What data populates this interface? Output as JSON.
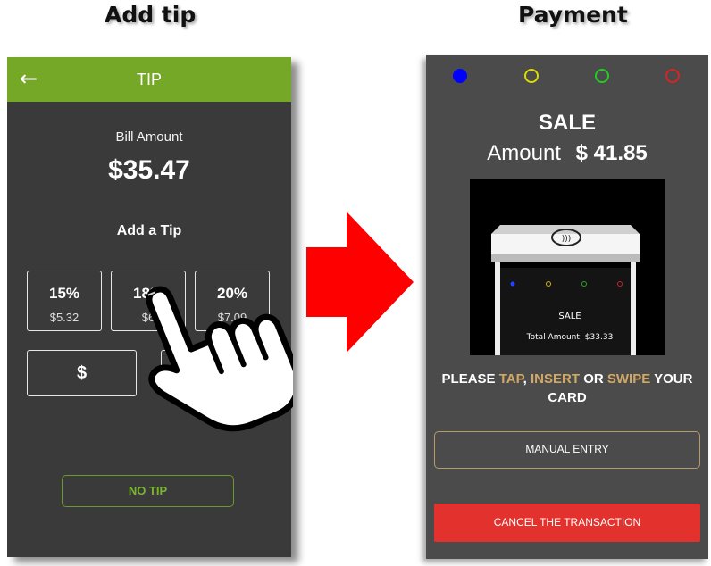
{
  "captions": {
    "left": "Add tip",
    "right": "Payment"
  },
  "tip_screen": {
    "title": "TIP",
    "bill_label": "Bill Amount",
    "bill_amount": "$35.47",
    "add_tip_label": "Add a Tip",
    "options": [
      {
        "percent": "15%",
        "amount": "$5.32"
      },
      {
        "percent": "18%",
        "amount": "$6"
      },
      {
        "percent": "20%",
        "amount": "$7.09"
      }
    ],
    "custom_label": "$",
    "no_tip_label": "NO TIP",
    "accent_color": "#76a828"
  },
  "payment_screen": {
    "leds": [
      {
        "name": "blue-led",
        "color": "#0000ff"
      },
      {
        "name": "yellow-led",
        "color": "#dcdc00"
      },
      {
        "name": "green-led",
        "color": "#22cc22"
      },
      {
        "name": "red-led",
        "color": "#dd2222"
      }
    ],
    "sale_label": "SALE",
    "amount_label": "Amount",
    "amount_value": "$ 41.85",
    "reader_screen": {
      "title": "SALE",
      "total_partial": "Total Amount: $33.33"
    },
    "prompt": {
      "p1": "PLEASE ",
      "tap": "TAP",
      "p2": ", ",
      "insert": "INSERT",
      "p3": " OR ",
      "swipe": "SWIPE",
      "p4": " YOUR CARD"
    },
    "manual_entry_label": "MANUAL ENTRY",
    "cancel_label": "CANCEL THE TRANSACTION",
    "cancel_color": "#e3322d",
    "highlight_color": "#d1a866"
  }
}
